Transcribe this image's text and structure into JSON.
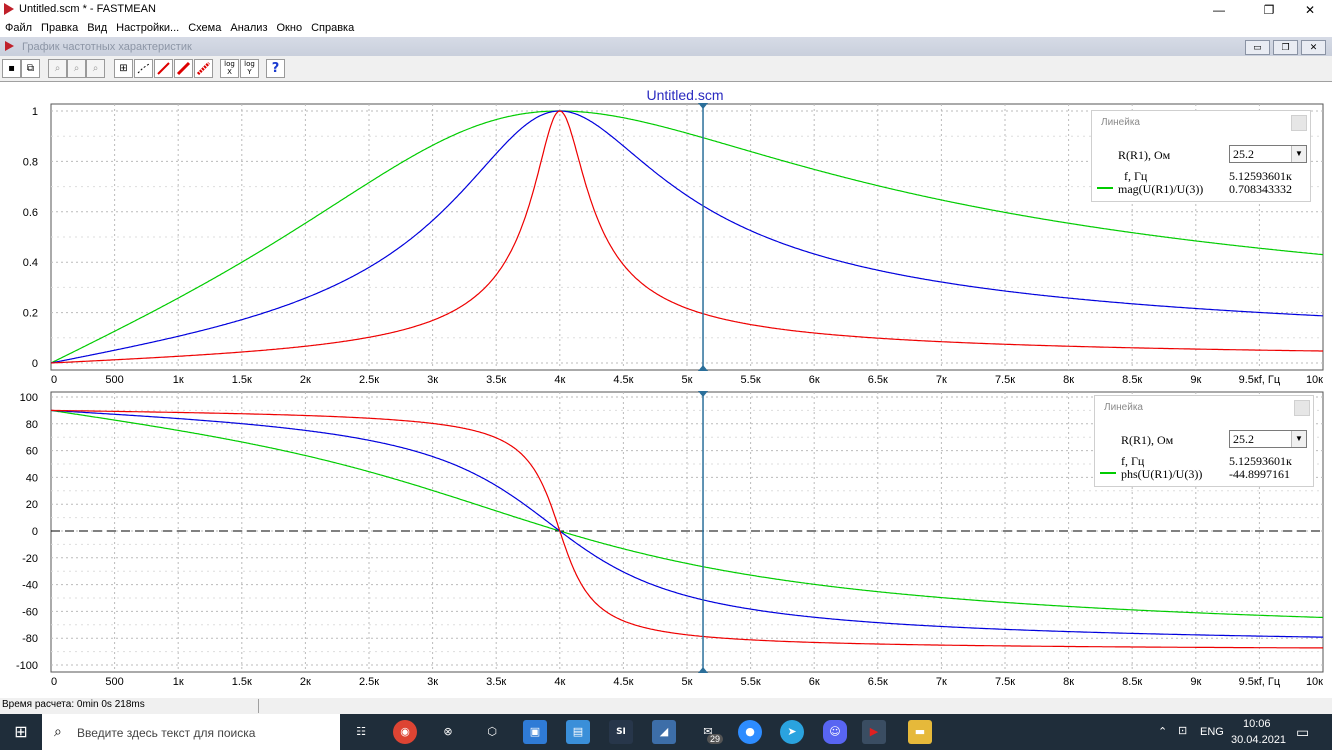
{
  "window": {
    "title": "Untitled.scm * - FASTMEAN",
    "minimize": "—",
    "maximize": "❐",
    "close": "✕"
  },
  "menu": [
    "Файл",
    "Правка",
    "Вид",
    "Настройки...",
    "Схема",
    "Анализ",
    "Окно",
    "Справка"
  ],
  "child_window": {
    "title": "График частотных характеристик",
    "buttons": [
      "▭",
      "❐",
      "✕"
    ]
  },
  "toolbar": {
    "log_x": "log X",
    "log_y": "log Y",
    "help": "?"
  },
  "plot_title": "Untitled.scm",
  "chart_data": [
    {
      "type": "line",
      "title": "Untitled.scm",
      "xlabel": "f, Гц",
      "x_ticks": [
        "0",
        "500",
        "1к",
        "1.5к",
        "2к",
        "2.5к",
        "3к",
        "3.5к",
        "4к",
        "4.5к",
        "5к",
        "5.5к",
        "6к",
        "6.5к",
        "7к",
        "7.5к",
        "8к",
        "8.5к",
        "9к",
        "9.5к",
        "10к"
      ],
      "y_ticks": [
        "1",
        "0.8",
        "0.6",
        "0.4",
        "0.2",
        "0"
      ],
      "xlim": [
        0,
        10000
      ],
      "ylim": [
        0,
        1
      ],
      "grid": true,
      "cursor_x": 5125.93601,
      "resonance_hz": 4000,
      "series": [
        {
          "color": "#00cc00",
          "Q": 1,
          "quantity": "magnitude"
        },
        {
          "color": "#0000dd",
          "Q": 2.5,
          "quantity": "magnitude"
        },
        {
          "color": "#ee0000",
          "Q": 10,
          "quantity": "magnitude"
        }
      ]
    },
    {
      "type": "line",
      "xlabel": "f, Гц",
      "x_ticks": [
        "0",
        "500",
        "1к",
        "1.5к",
        "2к",
        "2.5к",
        "3к",
        "3.5к",
        "4к",
        "4.5к",
        "5к",
        "5.5к",
        "6к",
        "6.5к",
        "7к",
        "7.5к",
        "8к",
        "8.5к",
        "9к",
        "9.5к",
        "10к"
      ],
      "y_ticks": [
        "100",
        "80",
        "60",
        "40",
        "20",
        "0",
        "-20",
        "-40",
        "-60",
        "-80",
        "-100"
      ],
      "xlim": [
        0,
        10000
      ],
      "ylim": [
        -100,
        100
      ],
      "grid": true,
      "zero_line": true,
      "cursor_x": 5125.93601,
      "resonance_hz": 4000,
      "series": [
        {
          "color": "#00cc00",
          "Q": 1,
          "quantity": "phase"
        },
        {
          "color": "#0000dd",
          "Q": 2.5,
          "quantity": "phase"
        },
        {
          "color": "#ee0000",
          "Q": 10,
          "quantity": "phase"
        }
      ]
    }
  ],
  "ruler_top": {
    "title": "Линейка",
    "param_label": "R(R1), Ом",
    "param_value": "25.2",
    "f_label": "f, Гц",
    "f_value": "5.12593601к",
    "trace_label": "mag(U(R1)/U(3))",
    "trace_value": "0.708343332"
  },
  "ruler_bottom": {
    "title": "Линейка",
    "param_label": "R(R1), Ом",
    "param_value": "25.2",
    "f_label": "f, Гц",
    "f_value": "5.12593601к",
    "trace_label": "phs(U(R1)/U(3))",
    "trace_value": "-44.8997161"
  },
  "status": {
    "calc_time": "Время расчета: 0min 0s 218ms"
  },
  "taskbar": {
    "search_placeholder": "Введите здесь текст для поиска",
    "mail_badge": "29",
    "lang": "ENG",
    "time": "10:06",
    "date": "30.04.2021"
  }
}
